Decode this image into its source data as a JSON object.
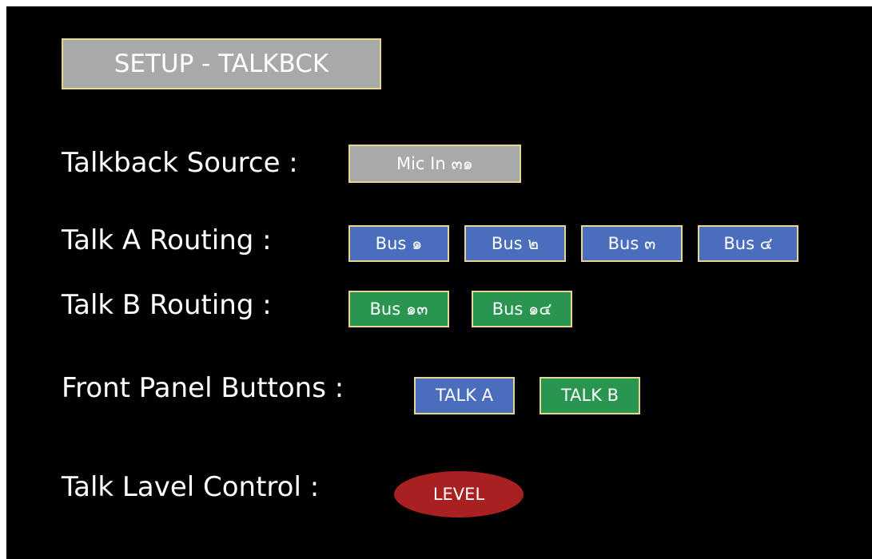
{
  "header": {
    "title": "SETUP - TALKBCK"
  },
  "talkback_source": {
    "label": "Talkback Source :",
    "value": "Mic In ๓๑"
  },
  "talk_a_routing": {
    "label": "Talk A Routing :",
    "buses": [
      "Bus ๑",
      "Bus ๒",
      "Bus ๓",
      "Bus ๔"
    ]
  },
  "talk_b_routing": {
    "label": "Talk B Routing :",
    "buses": [
      "Bus ๑๓",
      "Bus ๑๔"
    ]
  },
  "front_panel": {
    "label": "Front Panel Buttons :",
    "talk_a": "TALK A",
    "talk_b": "TALK B"
  },
  "level_control": {
    "label": "Talk Lavel Control :",
    "knob_label": "LEVEL"
  },
  "colors": {
    "background": "#000000",
    "grey": "#a8a9ab",
    "blue": "#4a6dbe",
    "green": "#2a9550",
    "red": "#a8201f",
    "border": "#e6d78c"
  }
}
